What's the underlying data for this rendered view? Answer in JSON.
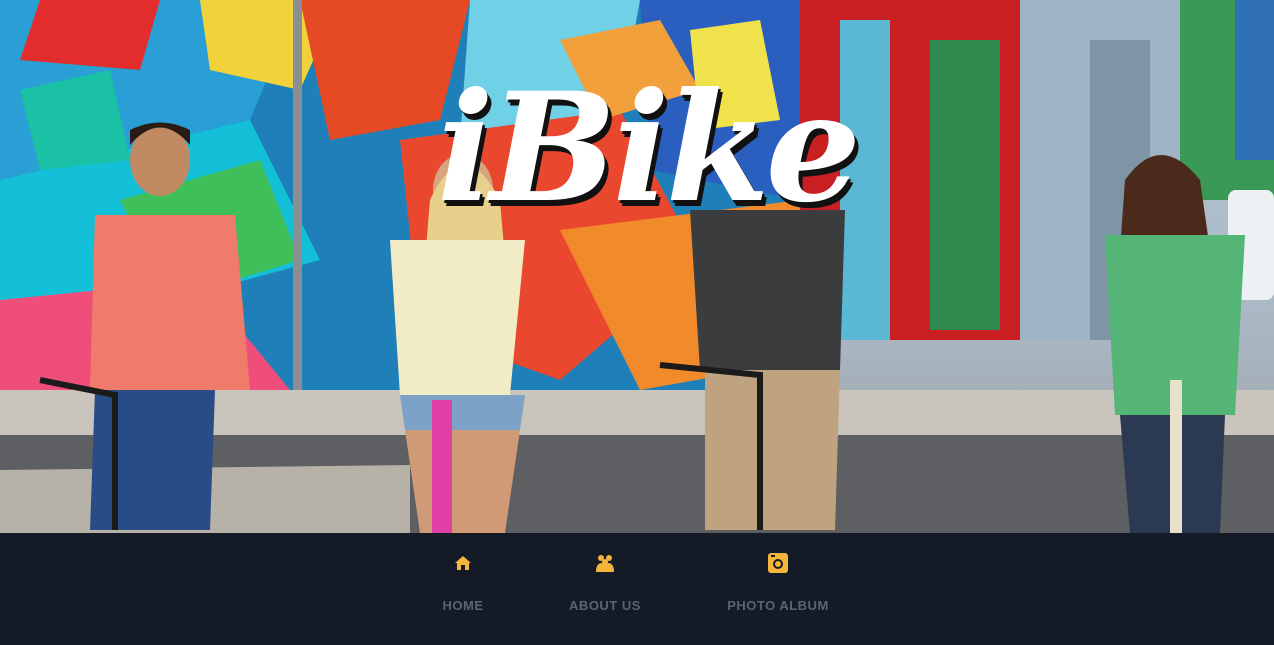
{
  "brand": {
    "logo_text": "iBike"
  },
  "hero": {
    "image": "photo-four-people-riding-bicycles-street-graffiti-wall"
  },
  "nav": {
    "items": [
      {
        "label": "HOME",
        "icon": "home-icon"
      },
      {
        "label": "ABOUT US",
        "icon": "group-icon"
      },
      {
        "label": "PHOTO ALBUM",
        "icon": "camera-icon"
      }
    ]
  },
  "colors": {
    "nav_background": "#151b26",
    "icon_accent": "#f3b53a",
    "nav_label": "#5c6370",
    "logo_text": "#ffffff"
  }
}
